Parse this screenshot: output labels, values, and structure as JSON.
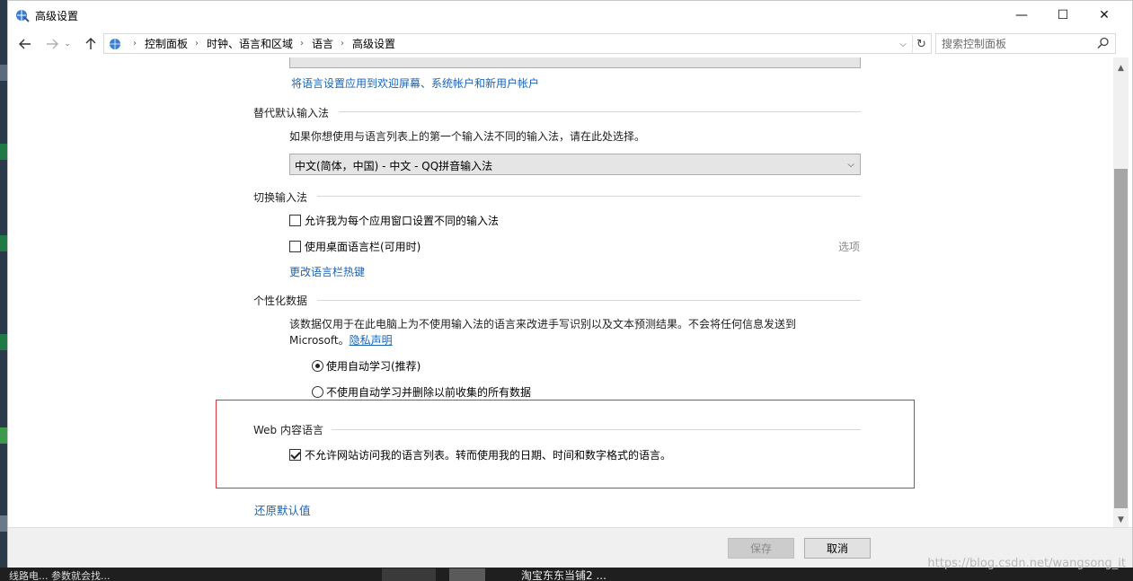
{
  "window": {
    "title": "高级设置",
    "controls": {
      "minimize": "—",
      "maximize": "☐",
      "close": "✕"
    }
  },
  "address_bar": {
    "breadcrumbs": [
      "控制面板",
      "时钟、语言和区域",
      "语言",
      "高级设置"
    ]
  },
  "search": {
    "placeholder": "搜索控制面板"
  },
  "content": {
    "welcome_link": "将语言设置应用到欢迎屏幕、系统帐户和新用户帐户",
    "override_input": {
      "title": "替代默认输入法",
      "description": "如果你想使用与语言列表上的第一个输入法不同的输入法，请在此处选择。",
      "selected": "中文(简体，中国) - 中文 - QQ拼音输入法"
    },
    "switch_input": {
      "title": "切换输入法",
      "option1": {
        "label": "允许我为每个应用窗口设置不同的输入法",
        "checked": false
      },
      "option2": {
        "label": "使用桌面语言栏(可用时)",
        "checked": false
      },
      "options_link": "选项",
      "hotkeys_link": "更改语言栏热键"
    },
    "personalization": {
      "title": "个性化数据",
      "description_line1": "该数据仅用于在此电脑上为不使用输入法的语言来改进手写识别以及文本预测结果。不会将任何信息发送到",
      "description_line2_prefix": "Microsoft。",
      "privacy_link": "隐私声明",
      "radio1": {
        "label": "使用自动学习(推荐)",
        "selected": true
      },
      "radio2": {
        "label": "不使用自动学习并删除以前收集的所有数据",
        "selected": false
      }
    },
    "web_language": {
      "title": "Web 内容语言",
      "checkbox": {
        "label": "不允许网站访问我的语言列表。转而使用我的日期、时间和数字格式的语言。",
        "checked": true
      }
    },
    "restore_defaults": "还原默认值"
  },
  "footer": {
    "save": "保存",
    "cancel": "取消"
  },
  "taskbar": {
    "left_text": "线路电... 参数就会找...",
    "item_text": "淘宝东东当铺2 ..."
  },
  "watermark": "https://blog.csdn.net/wangsong_it",
  "colors": {
    "link": "#1a64b8",
    "highlight_box": "#d9363e",
    "scroll_thumb": "#a6a6a6"
  }
}
